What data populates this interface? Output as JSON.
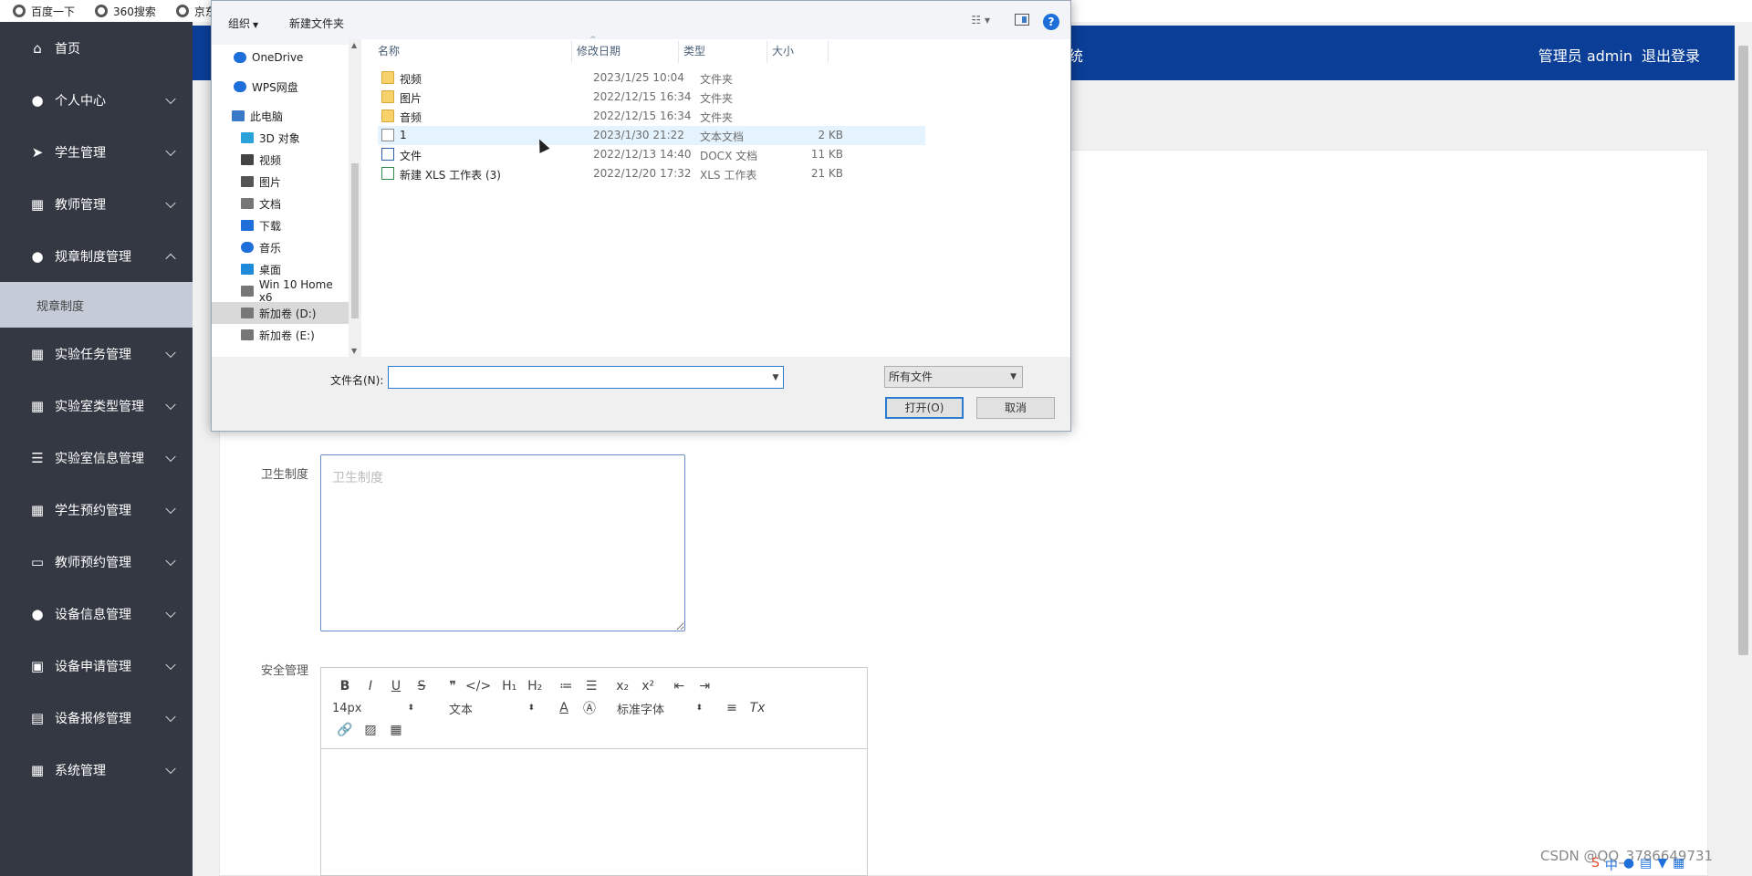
{
  "bookmarks": [
    {
      "label": "百度一下"
    },
    {
      "label": "360搜索"
    },
    {
      "label": "京东"
    }
  ],
  "sidebar": {
    "items": [
      {
        "label": "首页",
        "icon": "home-icon",
        "glyph": "⌂",
        "chevron": ""
      },
      {
        "label": "个人中心",
        "icon": "user-icon",
        "glyph": "●",
        "chevron": "down"
      },
      {
        "label": "学生管理",
        "icon": "send-icon",
        "glyph": "➤",
        "chevron": "down"
      },
      {
        "label": "教师管理",
        "icon": "grid-icon",
        "glyph": "▦",
        "chevron": "down"
      },
      {
        "label": "规章制度管理",
        "icon": "user-icon",
        "glyph": "●",
        "chevron": "up"
      },
      {
        "label": "实验任务管理",
        "icon": "grid-icon",
        "glyph": "▦",
        "chevron": "down"
      },
      {
        "label": "实验室类型管理",
        "icon": "grid-icon",
        "glyph": "▦",
        "chevron": "down"
      },
      {
        "label": "实验室信息管理",
        "icon": "list-icon",
        "glyph": "☰",
        "chevron": "down"
      },
      {
        "label": "学生预约管理",
        "icon": "grid-icon",
        "glyph": "▦",
        "chevron": "down"
      },
      {
        "label": "教师预约管理",
        "icon": "monitor-icon",
        "glyph": "▭",
        "chevron": "down"
      },
      {
        "label": "设备信息管理",
        "icon": "user-icon",
        "glyph": "●",
        "chevron": "down"
      },
      {
        "label": "设备申请管理",
        "icon": "briefcase-icon",
        "glyph": "▣",
        "chevron": "down"
      },
      {
        "label": "设备报修管理",
        "icon": "clipboard-icon",
        "glyph": "▤",
        "chevron": "down"
      },
      {
        "label": "系统管理",
        "icon": "grid-icon",
        "glyph": "▦",
        "chevron": "down"
      }
    ],
    "subitem": "规章制度"
  },
  "header": {
    "title_fragment": "统",
    "user_label": "管理员 admin",
    "logout_label": "退出登录"
  },
  "form": {
    "hygiene_label": "卫生制度",
    "hygiene_placeholder": "卫生制度",
    "safety_label": "安全管理"
  },
  "editor": {
    "row1": [
      "B",
      "I",
      "U",
      "S",
      "❞",
      "</>",
      "H₁",
      "H₂",
      "≔",
      "☰",
      "x₂",
      "x²",
      "⇤",
      "⇥"
    ],
    "font_size": "14px",
    "block_format": "文本",
    "font_family": "标准字体",
    "row2_tools": [
      "A",
      "Ⓐ",
      "≡",
      "Tx"
    ],
    "row3_tools": [
      "🔗",
      "▨",
      "▦"
    ]
  },
  "dialog": {
    "organize_label": "组织",
    "new_folder_label": "新建文件夹",
    "help_label": "?",
    "nav": [
      {
        "label": "OneDrive",
        "icon": "cloud-icon",
        "color": "#1e6fd9"
      },
      {
        "label": "WPS网盘",
        "icon": "cloud-icon",
        "color": "#1e6fd9"
      },
      {
        "label": "此电脑",
        "icon": "computer-icon",
        "color": "#3a78c8"
      },
      {
        "label": "3D 对象",
        "icon": "cube-icon",
        "color": "#2aa1d8"
      },
      {
        "label": "视频",
        "icon": "video-icon",
        "color": "#444444"
      },
      {
        "label": "图片",
        "icon": "picture-icon",
        "color": "#555555"
      },
      {
        "label": "文档",
        "icon": "document-icon",
        "color": "#777777"
      },
      {
        "label": "下载",
        "icon": "download-icon",
        "color": "#1e6fd9"
      },
      {
        "label": "音乐",
        "icon": "music-icon",
        "color": "#1e6fd9"
      },
      {
        "label": "桌面",
        "icon": "desktop-icon",
        "color": "#1e8ad9"
      },
      {
        "label": "Win 10 Home x6",
        "icon": "drive-icon",
        "color": "#777777"
      },
      {
        "label": "新加卷 (D:)",
        "icon": "drive-icon",
        "color": "#777777"
      },
      {
        "label": "新加卷 (E:)",
        "icon": "drive-icon",
        "color": "#777777"
      }
    ],
    "columns": [
      "名称",
      "修改日期",
      "类型",
      "大小"
    ],
    "files": [
      {
        "name": "视频",
        "date": "2023/1/25 10:04",
        "type": "文件夹",
        "size": "",
        "kind": "folder"
      },
      {
        "name": "图片",
        "date": "2022/12/15 16:34",
        "type": "文件夹",
        "size": "",
        "kind": "folder"
      },
      {
        "name": "音频",
        "date": "2022/12/15 16:34",
        "type": "文件夹",
        "size": "",
        "kind": "folder"
      },
      {
        "name": "1",
        "date": "2023/1/30 21:22",
        "type": "文本文档",
        "size": "2 KB",
        "kind": "txt"
      },
      {
        "name": "文件",
        "date": "2022/12/13 14:40",
        "type": "DOCX 文档",
        "size": "11 KB",
        "kind": "docx"
      },
      {
        "name": "新建 XLS 工作表 (3)",
        "date": "2022/12/20 17:32",
        "type": "XLS 工作表",
        "size": "21 KB",
        "kind": "xls"
      }
    ],
    "filename_label": "文件名(N):",
    "filename_value": "",
    "filetype_value": "所有文件",
    "open_label": "打开(O)",
    "cancel_label": "取消"
  },
  "watermark": "CSDN @QQ_3786649731"
}
